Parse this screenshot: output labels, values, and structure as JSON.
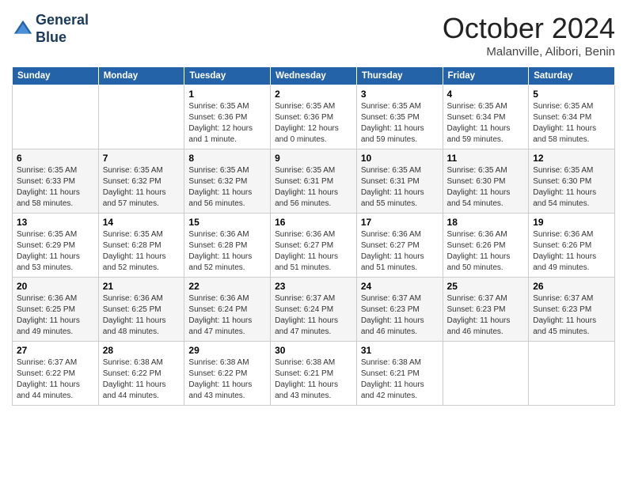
{
  "header": {
    "logo_line1": "General",
    "logo_line2": "Blue",
    "month_title": "October 2024",
    "subtitle": "Malanville, Alibori, Benin"
  },
  "days_of_week": [
    "Sunday",
    "Monday",
    "Tuesday",
    "Wednesday",
    "Thursday",
    "Friday",
    "Saturday"
  ],
  "weeks": [
    [
      {
        "day": "",
        "info": ""
      },
      {
        "day": "",
        "info": ""
      },
      {
        "day": "1",
        "info": "Sunrise: 6:35 AM\nSunset: 6:36 PM\nDaylight: 12 hours\nand 1 minute."
      },
      {
        "day": "2",
        "info": "Sunrise: 6:35 AM\nSunset: 6:36 PM\nDaylight: 12 hours\nand 0 minutes."
      },
      {
        "day": "3",
        "info": "Sunrise: 6:35 AM\nSunset: 6:35 PM\nDaylight: 11 hours\nand 59 minutes."
      },
      {
        "day": "4",
        "info": "Sunrise: 6:35 AM\nSunset: 6:34 PM\nDaylight: 11 hours\nand 59 minutes."
      },
      {
        "day": "5",
        "info": "Sunrise: 6:35 AM\nSunset: 6:34 PM\nDaylight: 11 hours\nand 58 minutes."
      }
    ],
    [
      {
        "day": "6",
        "info": "Sunrise: 6:35 AM\nSunset: 6:33 PM\nDaylight: 11 hours\nand 58 minutes."
      },
      {
        "day": "7",
        "info": "Sunrise: 6:35 AM\nSunset: 6:32 PM\nDaylight: 11 hours\nand 57 minutes."
      },
      {
        "day": "8",
        "info": "Sunrise: 6:35 AM\nSunset: 6:32 PM\nDaylight: 11 hours\nand 56 minutes."
      },
      {
        "day": "9",
        "info": "Sunrise: 6:35 AM\nSunset: 6:31 PM\nDaylight: 11 hours\nand 56 minutes."
      },
      {
        "day": "10",
        "info": "Sunrise: 6:35 AM\nSunset: 6:31 PM\nDaylight: 11 hours\nand 55 minutes."
      },
      {
        "day": "11",
        "info": "Sunrise: 6:35 AM\nSunset: 6:30 PM\nDaylight: 11 hours\nand 54 minutes."
      },
      {
        "day": "12",
        "info": "Sunrise: 6:35 AM\nSunset: 6:30 PM\nDaylight: 11 hours\nand 54 minutes."
      }
    ],
    [
      {
        "day": "13",
        "info": "Sunrise: 6:35 AM\nSunset: 6:29 PM\nDaylight: 11 hours\nand 53 minutes."
      },
      {
        "day": "14",
        "info": "Sunrise: 6:35 AM\nSunset: 6:28 PM\nDaylight: 11 hours\nand 52 minutes."
      },
      {
        "day": "15",
        "info": "Sunrise: 6:36 AM\nSunset: 6:28 PM\nDaylight: 11 hours\nand 52 minutes."
      },
      {
        "day": "16",
        "info": "Sunrise: 6:36 AM\nSunset: 6:27 PM\nDaylight: 11 hours\nand 51 minutes."
      },
      {
        "day": "17",
        "info": "Sunrise: 6:36 AM\nSunset: 6:27 PM\nDaylight: 11 hours\nand 51 minutes."
      },
      {
        "day": "18",
        "info": "Sunrise: 6:36 AM\nSunset: 6:26 PM\nDaylight: 11 hours\nand 50 minutes."
      },
      {
        "day": "19",
        "info": "Sunrise: 6:36 AM\nSunset: 6:26 PM\nDaylight: 11 hours\nand 49 minutes."
      }
    ],
    [
      {
        "day": "20",
        "info": "Sunrise: 6:36 AM\nSunset: 6:25 PM\nDaylight: 11 hours\nand 49 minutes."
      },
      {
        "day": "21",
        "info": "Sunrise: 6:36 AM\nSunset: 6:25 PM\nDaylight: 11 hours\nand 48 minutes."
      },
      {
        "day": "22",
        "info": "Sunrise: 6:36 AM\nSunset: 6:24 PM\nDaylight: 11 hours\nand 47 minutes."
      },
      {
        "day": "23",
        "info": "Sunrise: 6:37 AM\nSunset: 6:24 PM\nDaylight: 11 hours\nand 47 minutes."
      },
      {
        "day": "24",
        "info": "Sunrise: 6:37 AM\nSunset: 6:23 PM\nDaylight: 11 hours\nand 46 minutes."
      },
      {
        "day": "25",
        "info": "Sunrise: 6:37 AM\nSunset: 6:23 PM\nDaylight: 11 hours\nand 46 minutes."
      },
      {
        "day": "26",
        "info": "Sunrise: 6:37 AM\nSunset: 6:23 PM\nDaylight: 11 hours\nand 45 minutes."
      }
    ],
    [
      {
        "day": "27",
        "info": "Sunrise: 6:37 AM\nSunset: 6:22 PM\nDaylight: 11 hours\nand 44 minutes."
      },
      {
        "day": "28",
        "info": "Sunrise: 6:38 AM\nSunset: 6:22 PM\nDaylight: 11 hours\nand 44 minutes."
      },
      {
        "day": "29",
        "info": "Sunrise: 6:38 AM\nSunset: 6:22 PM\nDaylight: 11 hours\nand 43 minutes."
      },
      {
        "day": "30",
        "info": "Sunrise: 6:38 AM\nSunset: 6:21 PM\nDaylight: 11 hours\nand 43 minutes."
      },
      {
        "day": "31",
        "info": "Sunrise: 6:38 AM\nSunset: 6:21 PM\nDaylight: 11 hours\nand 42 minutes."
      },
      {
        "day": "",
        "info": ""
      },
      {
        "day": "",
        "info": ""
      }
    ]
  ]
}
